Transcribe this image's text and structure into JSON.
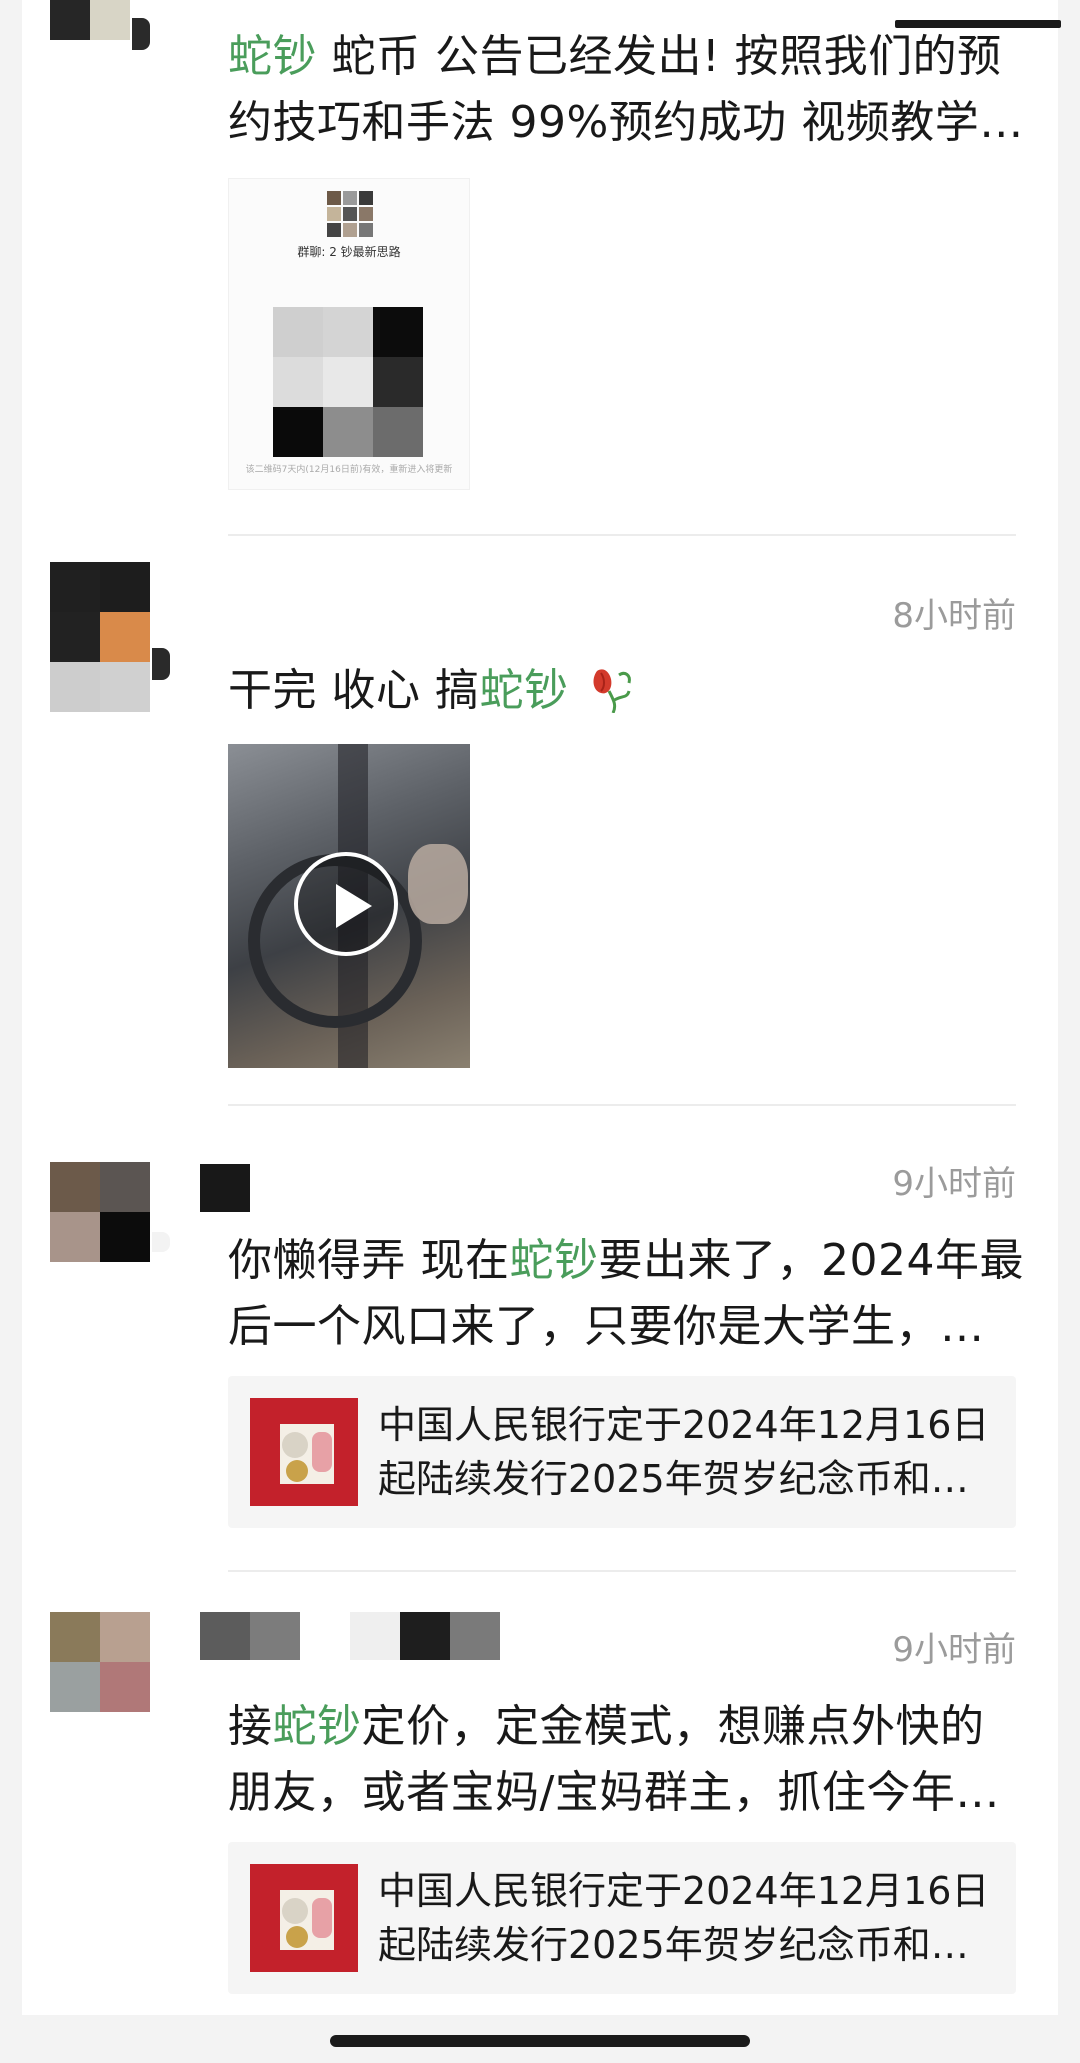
{
  "colors": {
    "highlight_green": "#4a9d5b",
    "text": "#191919",
    "timestamp": "#9b9b9b"
  },
  "posts": [
    {
      "line1_green": "蛇钞",
      "line1_rest": " 蛇币 公告已经发出! 按照我们的预",
      "line2": "约技巧和手法 99%预约成功 视频教学…",
      "qr_card": {
        "group_label": "群聊: 2 钞最新思路",
        "note": "该二维码7天内(12月16日前)有效，重新进入将更新"
      }
    },
    {
      "time": "8小时前",
      "text_before": "干完 收心 搞",
      "text_green": "蛇钞",
      "emoji": "wilted-flower-icon",
      "media": "video-play-icon"
    },
    {
      "time": "9小时前",
      "line1_before": "你懒得弄 现在",
      "line1_green": "蛇钞",
      "line1_after": "要出来了，2024年最",
      "line2": "后一个风口来了，只要你是大学生，…",
      "link": {
        "line1": "中国人民银行定于2024年12月16日",
        "line2": "起陆续发行2025年贺岁纪念币和…"
      }
    },
    {
      "time": "9小时前",
      "line1_before": "接",
      "line1_green": "蛇钞",
      "line1_after": "定价，定金模式，想赚点外快的",
      "line2": "朋友，或者宝妈/宝妈群主，抓住今年…",
      "link": {
        "line1": "中国人民银行定于2024年12月16日",
        "line2": "起陆续发行2025年贺岁纪念币和…"
      }
    }
  ]
}
